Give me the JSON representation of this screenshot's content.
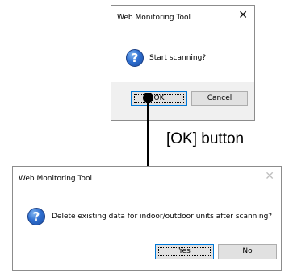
{
  "dialog1": {
    "title": "Web Monitoring Tool",
    "close_glyph": "✕",
    "icon_glyph": "?",
    "message": "Start scanning?",
    "ok_label": "OK",
    "cancel_label": "Cancel"
  },
  "annotation": {
    "label": "[OK] button"
  },
  "dialog2": {
    "title": "Web Monitoring Tool",
    "close_glyph": "✕",
    "icon_glyph": "?",
    "message": "Delete existing data for indoor/outdoor units after scanning?",
    "yes_label": "Yes",
    "no_label": "No"
  },
  "icons": {
    "question": "question-icon",
    "close": "close-icon"
  }
}
